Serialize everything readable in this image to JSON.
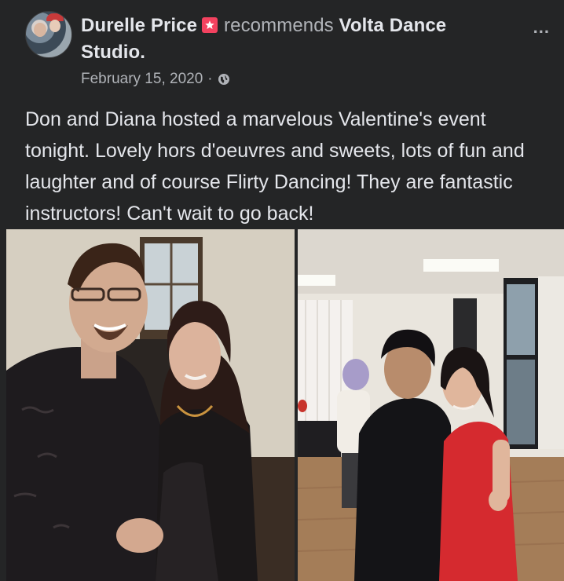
{
  "post": {
    "author": "Durelle Price",
    "verb": "recommends",
    "page_name_line1": "Volta Dance",
    "page_name_line2": "Studio.",
    "date": "February 15, 2020",
    "dot": "·",
    "more_label": "...",
    "body": "Don and Diana hosted a marvelous Valentine's event tonight. Lovely hors d'oeuvres and sweets, lots of fun and laughter and of course Flirty Dancing! They are fantastic instructors! Can't wait to go back!"
  },
  "icons": {
    "recommend": "recommend-badge-icon",
    "privacy": "globe-icon",
    "more": "more-options-icon"
  },
  "colors": {
    "background": "#242526",
    "primary_text": "#e4e6eb",
    "secondary_text": "#b0b3b8",
    "recommend_badge": "#f3425f"
  }
}
